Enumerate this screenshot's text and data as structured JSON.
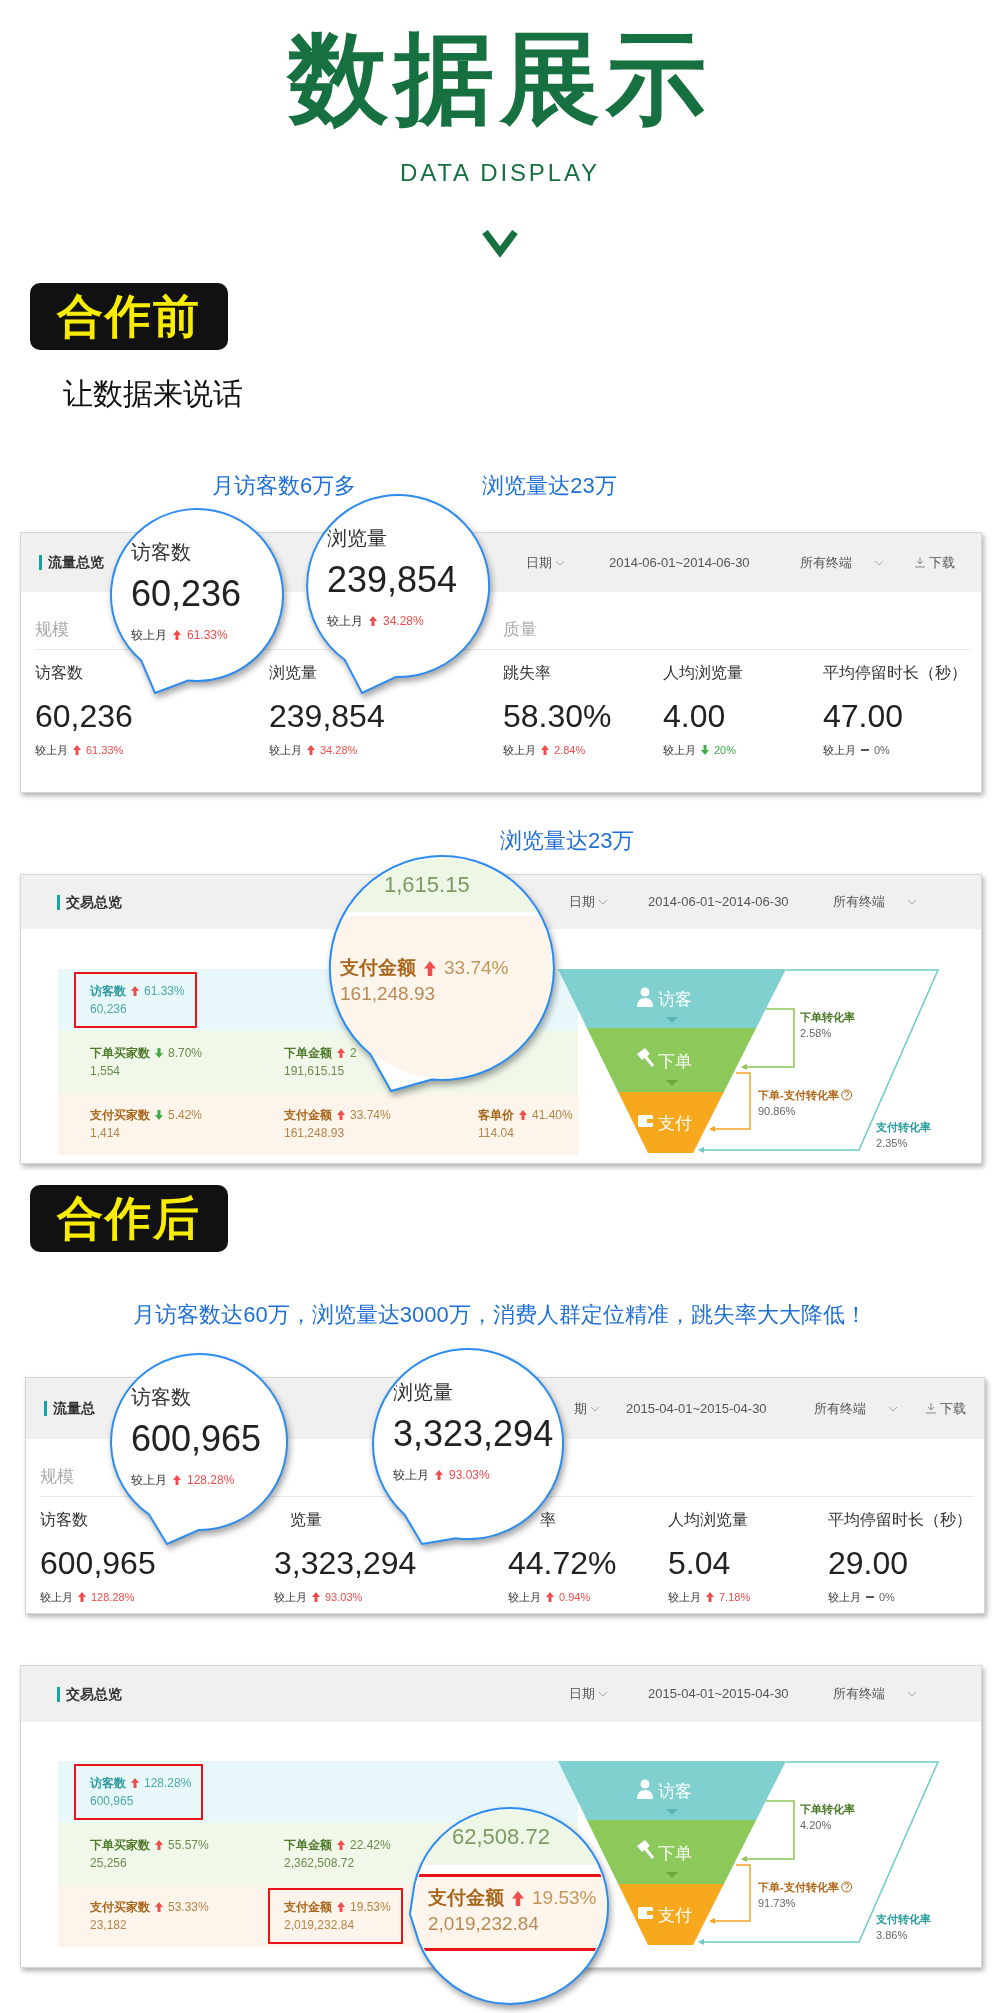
{
  "blocks": [
    {
      "kind": "title",
      "title": "数据展示",
      "subtitle": "DATA DISPLAY"
    },
    {
      "kind": "badge",
      "text": "合作前"
    },
    {
      "kind": "tagline",
      "text": "让数据来说话"
    },
    {
      "kind": "captions",
      "items": [
        "月访客数6万多",
        "浏览量达23万"
      ]
    },
    {
      "kind": "traffic_panel",
      "title": "流量总览",
      "date_label": "日期",
      "date_range": "2014-06-01~2014-06-30",
      "device": "所有终端",
      "download": "下载",
      "groups": [
        {
          "title": "规模",
          "metrics": [
            {
              "label": "访客数",
              "value": "60,236",
              "compare": "较上月",
              "rising": true,
              "falling": false,
              "change": "61.33%"
            },
            {
              "label": "浏览量",
              "value": "239,854",
              "compare": "较上月",
              "rising": true,
              "falling": false,
              "change": "34.28%"
            }
          ]
        },
        {
          "title": "质量",
          "metrics": [
            {
              "label": "跳失率",
              "value": "58.30%",
              "compare": "较上月",
              "rising": true,
              "falling": false,
              "change": "2.84%"
            },
            {
              "label": "人均浏览量",
              "value": "4.00",
              "compare": "较上月",
              "rising": false,
              "falling": true,
              "change": "20%"
            },
            {
              "label": "平均停留时长（秒）",
              "value": "47.00",
              "compare": "较上月",
              "rising": false,
              "falling": false,
              "change": "0%"
            }
          ]
        }
      ],
      "bubbles": [
        {
          "label": "访客数",
          "value": "60,236",
          "compare": "较上月",
          "rising": true,
          "falling": false,
          "change": "61.33%"
        },
        {
          "label": "浏览量",
          "value": "239,854",
          "compare": "较上月",
          "rising": true,
          "falling": false,
          "change": "34.28%"
        }
      ]
    },
    {
      "kind": "captions",
      "items": [
        "浏览量达23万"
      ]
    },
    {
      "kind": "trade_panel",
      "title": "交易总览",
      "date_label": "日期",
      "date_range": "2014-06-01~2014-06-30",
      "device": "所有终端",
      "rows": [
        {
          "kind": "visitor",
          "cells": [
            {
              "label": "访客数",
              "rising": true,
              "falling": false,
              "change": "61.33%",
              "value": "60,236",
              "highlighted": true
            }
          ]
        },
        {
          "kind": "order",
          "cells": [
            {
              "label": "下单买家数",
              "rising": false,
              "falling": true,
              "change": "8.70%",
              "value": "1,554",
              "highlighted": false
            },
            {
              "label": "下单金额",
              "rising": true,
              "falling": false,
              "change": "2",
              "value": "191,615.15",
              "highlighted": false
            }
          ]
        },
        {
          "kind": "payment",
          "cells": [
            {
              "label": "支付买家数",
              "rising": false,
              "falling": true,
              "change": "5.42%",
              "value": "1,414",
              "highlighted": false
            },
            {
              "label": "支付金额",
              "rising": true,
              "falling": false,
              "change": "33.74%",
              "value": "161,248.93",
              "highlighted": false
            },
            {
              "label": "客单价",
              "rising": true,
              "falling": false,
              "change": "41.40%",
              "value": "114.04",
              "highlighted": false
            }
          ]
        }
      ],
      "funnel": [
        {
          "kind": "visitor",
          "label": "访客"
        },
        {
          "kind": "order",
          "label": "下单"
        },
        {
          "kind": "payment",
          "label": "支付"
        }
      ],
      "rates": [
        {
          "kind": "order",
          "label": "下单转化率",
          "value": "2.58%",
          "help": false
        },
        {
          "kind": "payment",
          "label": "下单-支付转化率",
          "value": "90.86%",
          "help": true
        },
        {
          "kind": "overall",
          "label": "支付转化率",
          "value": "2.35%",
          "help": false
        }
      ],
      "bubble": {
        "top_value": "1,615.15",
        "label": "支付金额",
        "rising": true,
        "falling": false,
        "change": "33.74%",
        "value": "161,248.93",
        "highlighted": false
      }
    },
    {
      "kind": "badge",
      "text": "合作后"
    },
    {
      "kind": "captions",
      "items": [
        "月访客数达60万，浏览量达3000万，消费人群定位精准，跳失率大大降低！"
      ]
    },
    {
      "kind": "traffic_panel",
      "title": "流量总",
      "date_label": "期",
      "date_range": "2015-04-01~2015-04-30",
      "device": "所有终端",
      "download": "下载",
      "groups": [
        {
          "title": "规模",
          "metrics": [
            {
              "label": "访客数",
              "value": "600,965",
              "compare": "较上月",
              "rising": true,
              "falling": false,
              "change": "128.28%"
            },
            {
              "label": "览量",
              "value": "3,323,294",
              "compare": "较上月",
              "rising": true,
              "falling": false,
              "change": "93.03%"
            }
          ]
        },
        {
          "metrics": [
            {
              "label": "率",
              "value": "44.72%",
              "compare": "较上月",
              "rising": true,
              "falling": false,
              "change": "0.94%"
            },
            {
              "label": "人均浏览量",
              "value": "5.04",
              "compare": "较上月",
              "rising": true,
              "falling": false,
              "change": "7.18%"
            },
            {
              "label": "平均停留时长（秒）",
              "value": "29.00",
              "compare": "较上月",
              "rising": false,
              "falling": false,
              "change": "0%"
            }
          ]
        }
      ],
      "bubbles": [
        {
          "label": "访客数",
          "value": "600,965",
          "compare": "较上月",
          "rising": true,
          "falling": false,
          "change": "128.28%"
        },
        {
          "label": "浏览量",
          "value": "3,323,294",
          "compare": "较上月",
          "rising": true,
          "falling": false,
          "change": "93.03%"
        }
      ]
    },
    {
      "kind": "trade_panel",
      "title": "交易总览",
      "date_label": "日期",
      "date_range": "2015-04-01~2015-04-30",
      "device": "所有终端",
      "rows": [
        {
          "kind": "visitor",
          "cells": [
            {
              "label": "访客数",
              "rising": true,
              "falling": false,
              "change": "128.28%",
              "value": "600,965",
              "highlighted": true
            }
          ]
        },
        {
          "kind": "order",
          "cells": [
            {
              "label": "下单买家数",
              "rising": true,
              "falling": false,
              "change": "55.57%",
              "value": "25,256",
              "highlighted": false
            },
            {
              "label": "下单金额",
              "rising": true,
              "falling": false,
              "change": "22.42%",
              "value": "2,362,508.72",
              "highlighted": false
            }
          ]
        },
        {
          "kind": "payment",
          "cells": [
            {
              "label": "支付买家数",
              "rising": true,
              "falling": false,
              "change": "53.33%",
              "value": "23,182",
              "highlighted": false
            },
            {
              "label": "支付金额",
              "rising": true,
              "falling": false,
              "change": "19.53%",
              "value": "2,019,232.84",
              "highlighted": true
            }
          ]
        }
      ],
      "funnel": [
        {
          "kind": "visitor",
          "label": "访客"
        },
        {
          "kind": "order",
          "label": "下单"
        },
        {
          "kind": "payment",
          "label": "支付"
        }
      ],
      "rates": [
        {
          "kind": "order",
          "label": "下单转化率",
          "value": "4.20%",
          "help": false
        },
        {
          "kind": "payment",
          "label": "下单-支付转化率",
          "value": "91.73%",
          "help": true
        },
        {
          "kind": "overall",
          "label": "支付转化率",
          "value": "3.86%",
          "help": false
        }
      ],
      "bubble": {
        "top_value": "62,508.72",
        "label": "支付金额",
        "rising": true,
        "falling": false,
        "change": "19.53%",
        "value": "2,019,232.84",
        "highlighted": true
      }
    }
  ]
}
